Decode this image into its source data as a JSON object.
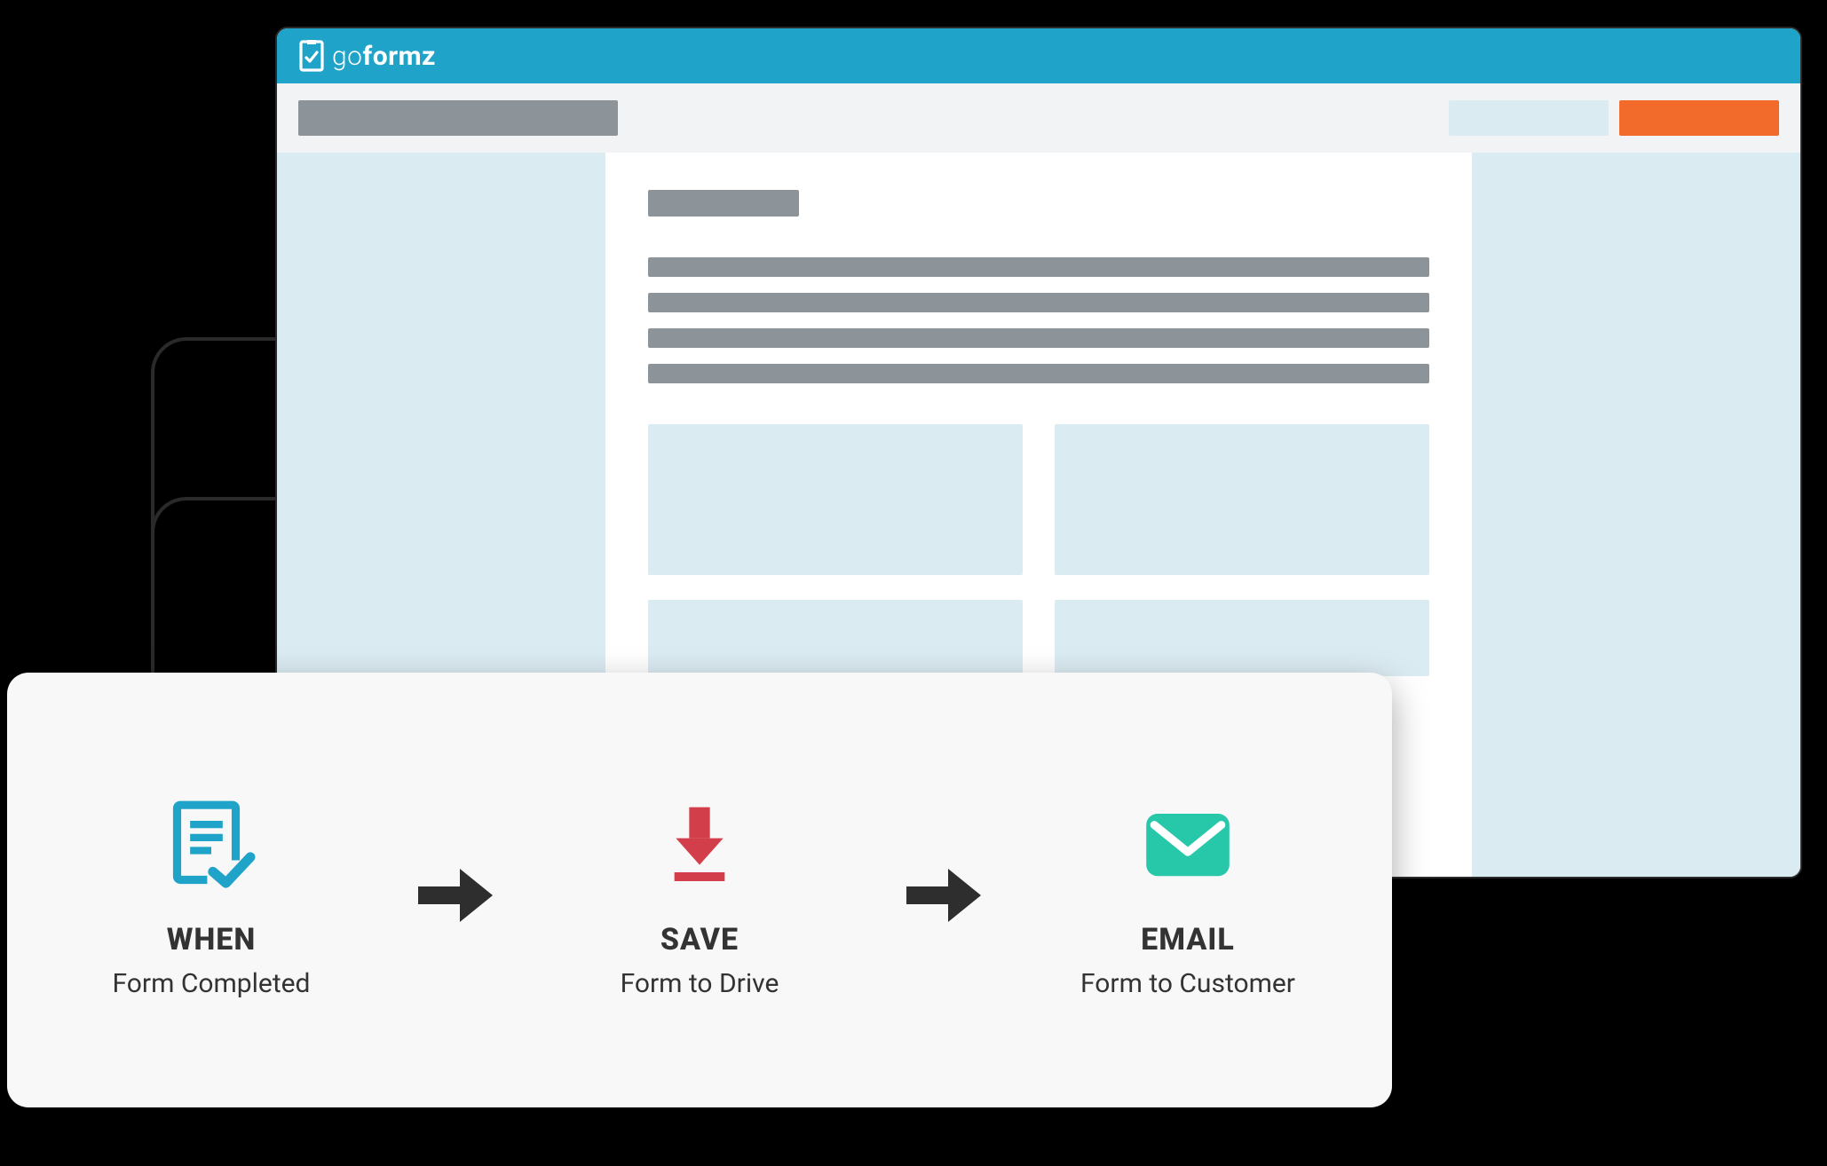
{
  "brand": {
    "name_prefix": "go",
    "name_suffix": "formz"
  },
  "colors": {
    "brand_bar": "#1fa3c8",
    "accent_orange": "#f26b2a",
    "muted_panel": "#dbebf2",
    "placeholder": "#8d9499",
    "flow_form_icon": "#1fa3c8",
    "flow_download_icon": "#d23f4a",
    "flow_email_icon": "#27c7a9",
    "arrow": "#2e2e2e"
  },
  "flow": {
    "steps": [
      {
        "title": "WHEN",
        "subtitle": "Form Completed",
        "icon": "form-check-icon"
      },
      {
        "title": "SAVE",
        "subtitle": "Form to Drive",
        "icon": "download-icon"
      },
      {
        "title": "EMAIL",
        "subtitle": "Form to Customer",
        "icon": "mail-icon"
      }
    ]
  }
}
